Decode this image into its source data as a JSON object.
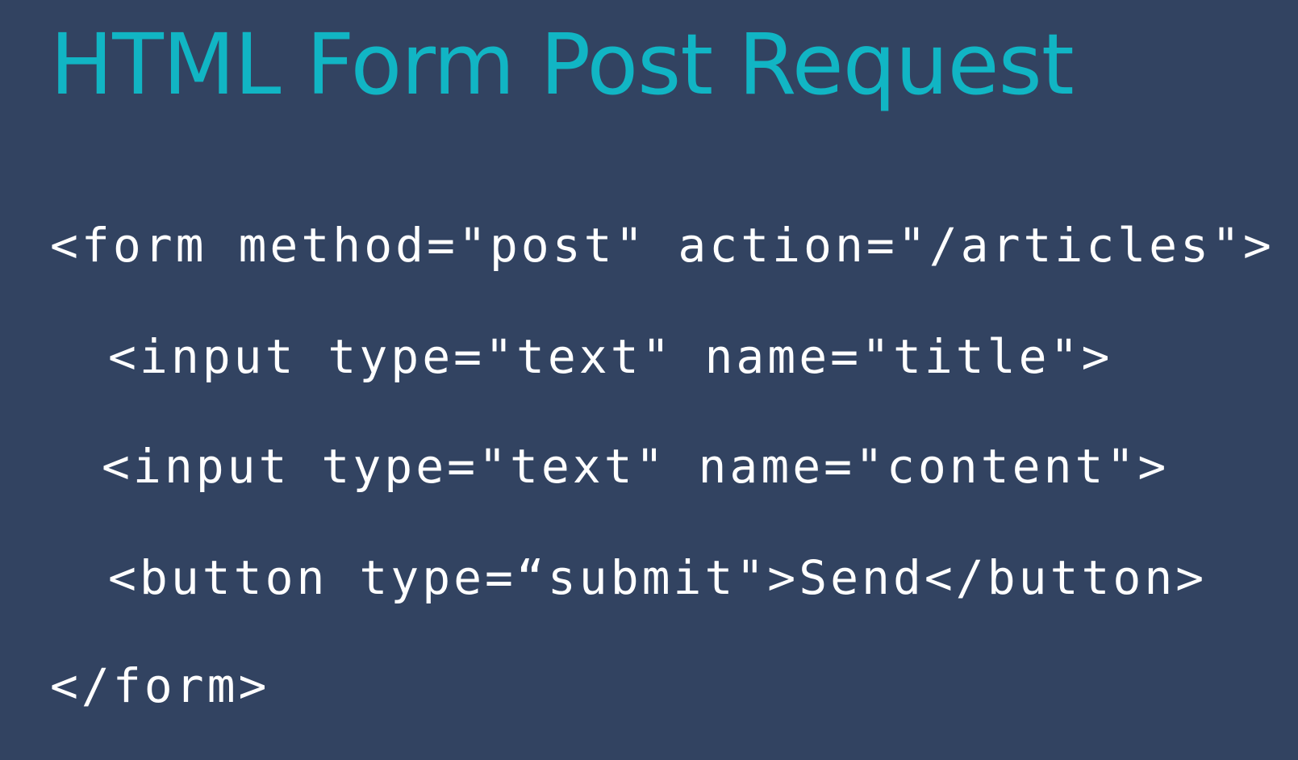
{
  "slide": {
    "title": "HTML Form Post Request",
    "code_lines": [
      "<form method=\"post\" action=\"/articles\">",
      "<input type=\"text\" name=\"title\">",
      "<input type=\"text\" name=\"content\">",
      "<button type=“submit\">Send</button>",
      "</form>"
    ]
  },
  "colors": {
    "background": "#324361",
    "title": "#11b5c4",
    "code_text": "#ffffff"
  }
}
